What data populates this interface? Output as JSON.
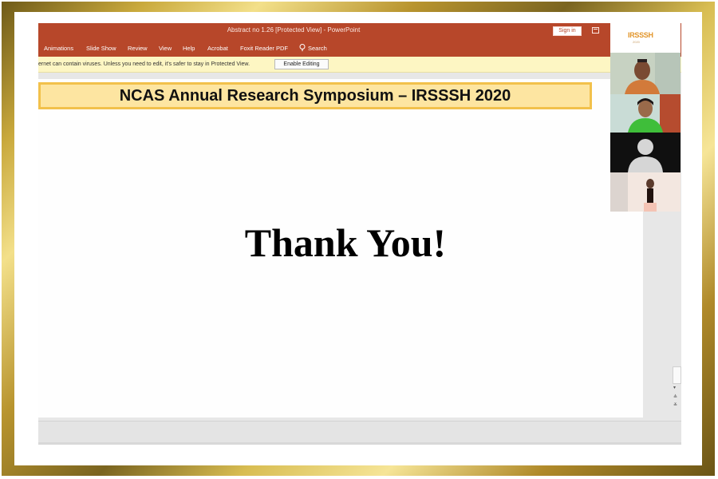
{
  "window": {
    "title": "Abstract  no 1.26 [Protected View]  -  PowerPoint",
    "signin_label": "Sign in"
  },
  "ribbon": {
    "tabs": [
      "Animations",
      "Slide Show",
      "Review",
      "View",
      "Help",
      "Acrobat",
      "Foxit Reader PDF"
    ],
    "search_label": "Search"
  },
  "protected_bar": {
    "message": "ernet can contain viruses. Unless you need to edit, it's safer to stay in Protected View.",
    "button_label": "Enable Editing"
  },
  "slide": {
    "banner_text": "NCAS Annual Research Symposium – IRSSSH 2020",
    "body_text": "Thank You!"
  },
  "video_call": {
    "logo_text": "IRSSSH",
    "logo_sub": "2020"
  },
  "colors": {
    "ribbon": "#b7472a",
    "banner_fill": "#fde5a1",
    "banner_border": "#f2c14b",
    "frame_gold": "#c9a93c",
    "protected_bar": "#fdf6c3"
  },
  "icons": [
    "lightbulb-search-icon",
    "ribbon-display-options-icon",
    "scroll-up-icon",
    "scroll-down-icon",
    "prev-slide-icon",
    "next-slide-icon",
    "user-placeholder-icon"
  ]
}
